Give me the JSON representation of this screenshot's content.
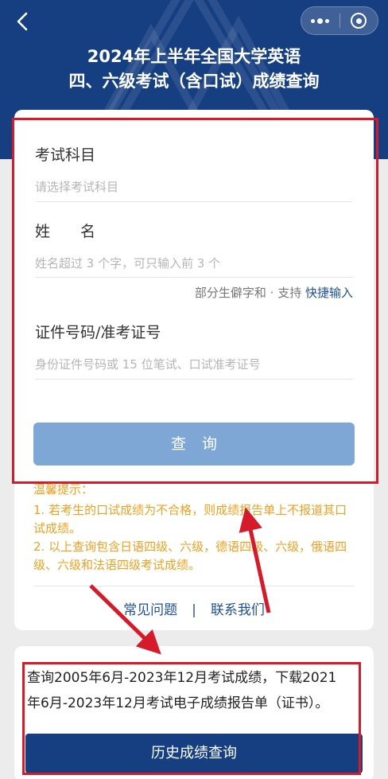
{
  "header": {
    "title_line1": "2024年上半年全国大学英语",
    "title_line2": "四、六级考试（含口试）成绩查询",
    "back_icon": "chevron-left-icon",
    "capsule_icons": [
      "more-dots-icon",
      "target-icon"
    ],
    "bg_color": "#163f82"
  },
  "form": {
    "subject": {
      "label": "考试科目",
      "placeholder": "请选择考试科目"
    },
    "name": {
      "label": "姓　　名",
      "placeholder": "姓名超过 3 个字，可只输入前 3 个"
    },
    "rare_char_hint": "部分生僻字和 · 支持",
    "quick_input_link": "快捷输入",
    "id": {
      "label": "证件号码/准考证号",
      "placeholder": "身份证件号码或 15 位笔试、口试准考证号"
    },
    "query_button": "查询",
    "button_color": "#7fa7d6"
  },
  "tips": {
    "title": "温馨提示：",
    "items": [
      "1. 若考生的口试成绩为不合格，则成绩报告单上不报道其口试成绩。",
      "2. 以上查询包含日语四级、六级，德语四级、六级，俄语四级、六级和法语四级考试成绩。"
    ],
    "color": "#f0a020"
  },
  "links": {
    "faq": "常见问题",
    "separator": "|",
    "contact": "联系我们"
  },
  "history": {
    "line1": "查询2005年6月-2023年12月考试成绩，下载2021",
    "line2": "年6月-2023年12月考试电子成绩报告单（证书）。",
    "button": "历史成绩查询"
  },
  "annotation_color": "#d51a2a"
}
